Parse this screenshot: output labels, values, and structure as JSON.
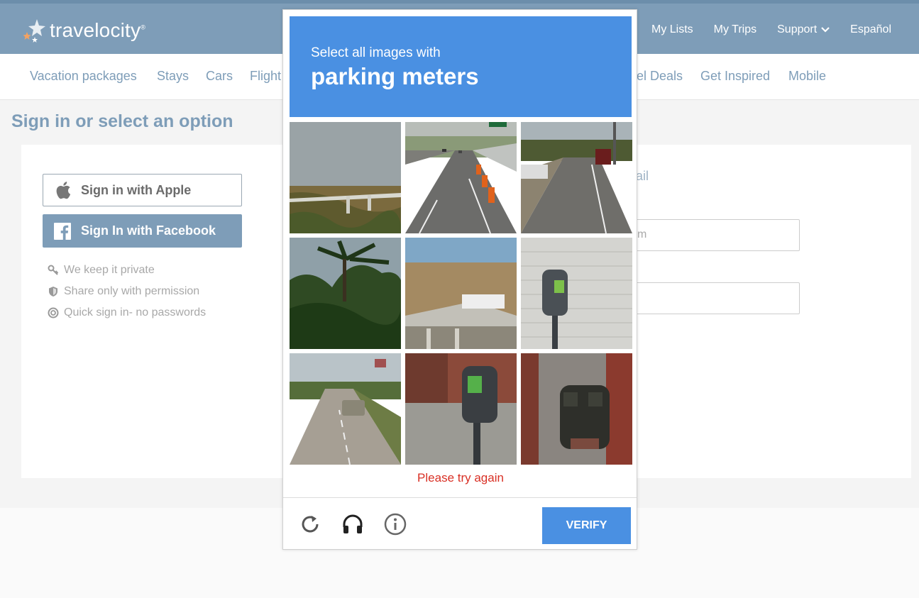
{
  "brand": {
    "name": "travelocity",
    "registered": "®"
  },
  "top_nav": {
    "items": [
      "My Lists",
      "My Trips",
      "Support",
      "Español"
    ]
  },
  "sub_nav": {
    "items": [
      "Vacation packages",
      "Stays",
      "Cars",
      "Flight",
      "el Deals",
      "Get Inspired",
      "Mobile"
    ]
  },
  "page": {
    "title": "Sign in or select an option",
    "apple_button": "Sign in with Apple",
    "facebook_button": "Sign In with Facebook",
    "perks": [
      "We keep it private",
      "Share only with permission",
      "Quick sign in- no passwords"
    ],
    "email_fragment": "ail",
    "field1_fragment": "m"
  },
  "captcha": {
    "prompt": "Select all images with",
    "target": "parking meters",
    "error": "Please try again",
    "verify_label": "VERIFY",
    "tiles": [
      "bridge-tile",
      "highway-cones-tile",
      "road-traffic-tile",
      "palm-trees-tile",
      "overpass-tile",
      "parking-meter-wall-tile",
      "rural-road-tile",
      "parking-meter-sidewalk-tile",
      "double-meter-tile"
    ]
  },
  "colors": {
    "header": "#7e9db8",
    "captcha_blue": "#4a90e2",
    "error_red": "#d93025"
  }
}
